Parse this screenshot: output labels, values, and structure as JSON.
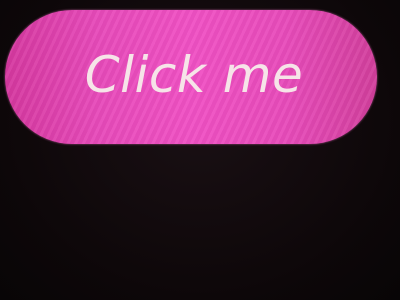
{
  "button": {
    "label": "Click me",
    "background_color": "#e74aba",
    "text_color": "#f6e4e8"
  },
  "screen": {
    "background_color": "#110a0d"
  }
}
